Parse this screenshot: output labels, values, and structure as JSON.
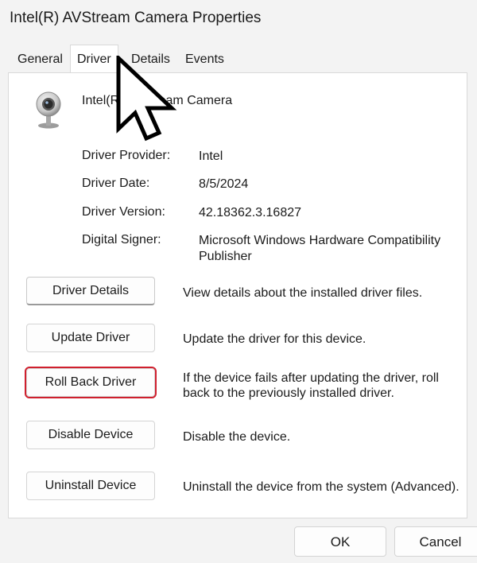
{
  "window": {
    "title": "Intel(R) AVStream Camera Properties"
  },
  "tabs": [
    {
      "label": "General",
      "active": false
    },
    {
      "label": "Driver",
      "active": true
    },
    {
      "label": "Details",
      "active": false
    },
    {
      "label": "Events",
      "active": false
    }
  ],
  "device": {
    "icon": "webcam-icon",
    "name": "Intel(R) AVStream Camera"
  },
  "properties": [
    {
      "label": "Driver Provider:",
      "value": "Intel"
    },
    {
      "label": "Driver Date:",
      "value": "8/5/2024"
    },
    {
      "label": "Driver Version:",
      "value": "42.18362.3.16827"
    },
    {
      "label": "Digital Signer:",
      "value": "Microsoft Windows Hardware Compatibility Publisher"
    }
  ],
  "actions": [
    {
      "label": "Driver Details",
      "description": "View details about the installed driver files."
    },
    {
      "label": "Update Driver",
      "description": "Update the driver for this device."
    },
    {
      "label": "Roll Back Driver",
      "description": "If the device fails after updating the driver, roll back to the previously installed driver."
    },
    {
      "label": "Disable Device",
      "description": "Disable the device."
    },
    {
      "label": "Uninstall Device",
      "description": "Uninstall the device from the system (Advanced)."
    }
  ],
  "footer": {
    "ok_label": "OK",
    "cancel_label": "Cancel"
  },
  "colors": {
    "highlight_border": "#d0202e",
    "panel_background": "#ffffff",
    "window_background": "#f3f3f3"
  },
  "cursor": {
    "icon": "mouse-pointer-icon"
  }
}
